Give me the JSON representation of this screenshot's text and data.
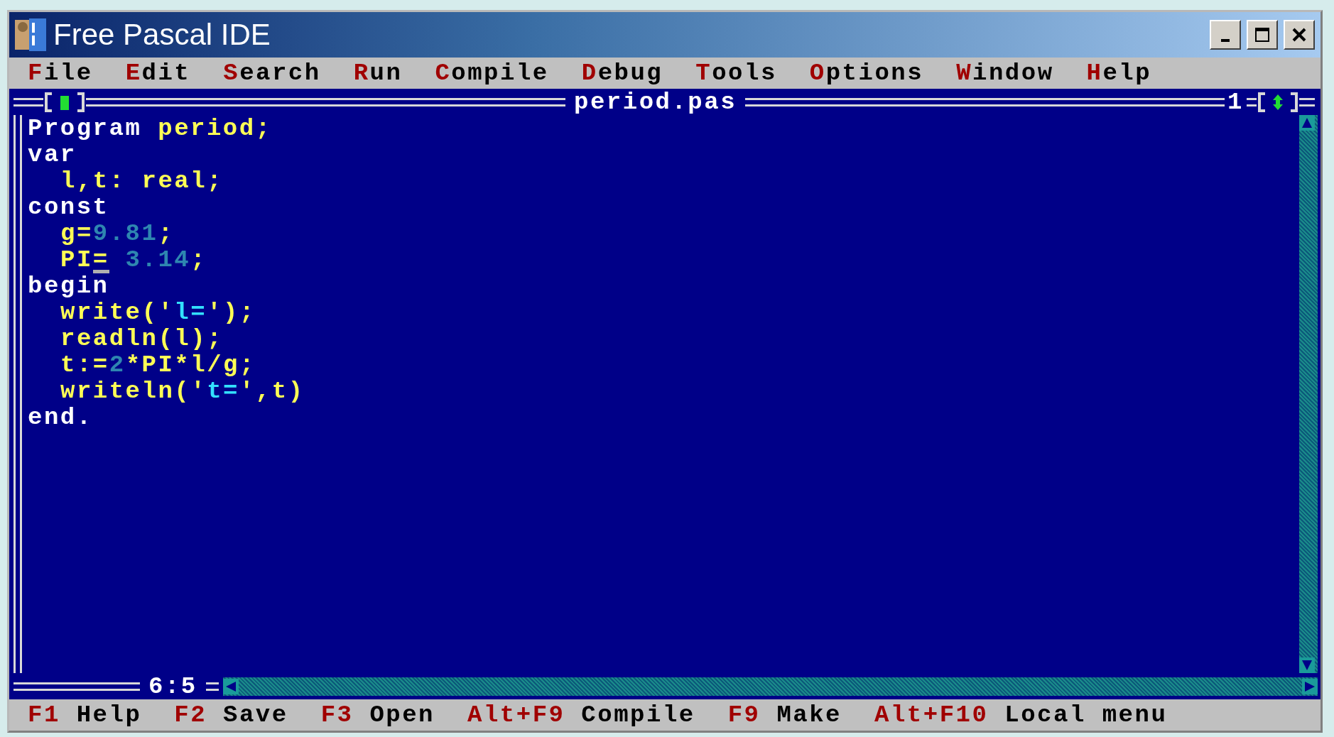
{
  "window": {
    "title": "Free Pascal IDE"
  },
  "menu": [
    {
      "hotkey": "F",
      "rest": "ile"
    },
    {
      "hotkey": "E",
      "rest": "dit"
    },
    {
      "hotkey": "S",
      "rest": "earch"
    },
    {
      "hotkey": "R",
      "rest": "un"
    },
    {
      "hotkey": "C",
      "rest": "ompile"
    },
    {
      "hotkey": "D",
      "rest": "ebug"
    },
    {
      "hotkey": "T",
      "rest": "ools"
    },
    {
      "hotkey": "O",
      "rest": "ptions"
    },
    {
      "hotkey": "W",
      "rest": "indow"
    },
    {
      "hotkey": "H",
      "rest": "elp"
    }
  ],
  "editor": {
    "file_name": "period.pas",
    "window_number": "1",
    "position": "6:5",
    "lines": [
      {
        "indent": false,
        "tokens": [
          {
            "text": "Program",
            "kind": "reserved",
            "cursor": false
          },
          {
            "text": " period;",
            "kind": "ident",
            "cursor": false
          }
        ]
      },
      {
        "indent": false,
        "tokens": [
          {
            "text": "var",
            "kind": "reserved",
            "cursor": false
          }
        ]
      },
      {
        "indent": true,
        "tokens": [
          {
            "text": "l,t: real;",
            "kind": "ident",
            "cursor": false
          }
        ]
      },
      {
        "indent": false,
        "tokens": [
          {
            "text": "const",
            "kind": "reserved",
            "cursor": false
          }
        ]
      },
      {
        "indent": true,
        "tokens": [
          {
            "text": "g=",
            "kind": "ident",
            "cursor": false
          },
          {
            "text": "9.81",
            "kind": "number",
            "cursor": false
          },
          {
            "text": ";",
            "kind": "ident",
            "cursor": false
          }
        ]
      },
      {
        "indent": true,
        "tokens": [
          {
            "text": "PI",
            "kind": "ident",
            "cursor": false
          },
          {
            "text": "=",
            "kind": "ident",
            "cursor": true
          },
          {
            "text": " 3.14",
            "kind": "number",
            "cursor": false
          },
          {
            "text": ";",
            "kind": "ident",
            "cursor": false
          }
        ]
      },
      {
        "indent": false,
        "tokens": [
          {
            "text": "begin",
            "kind": "reserved",
            "cursor": false
          }
        ]
      },
      {
        "indent": true,
        "tokens": [
          {
            "text": "write('",
            "kind": "ident",
            "cursor": false
          },
          {
            "text": "l=",
            "kind": "string",
            "cursor": false
          },
          {
            "text": "');",
            "kind": "ident",
            "cursor": false
          }
        ]
      },
      {
        "indent": true,
        "tokens": [
          {
            "text": "readln(l);",
            "kind": "ident",
            "cursor": false
          }
        ]
      },
      {
        "indent": true,
        "tokens": [
          {
            "text": "t:=",
            "kind": "ident",
            "cursor": false
          },
          {
            "text": "2",
            "kind": "number",
            "cursor": false
          },
          {
            "text": "*PI*l/g;",
            "kind": "ident",
            "cursor": false
          }
        ]
      },
      {
        "indent": true,
        "tokens": [
          {
            "text": "writeln('",
            "kind": "ident",
            "cursor": false
          },
          {
            "text": "t=",
            "kind": "string",
            "cursor": false
          },
          {
            "text": "',t)",
            "kind": "ident",
            "cursor": false
          }
        ]
      },
      {
        "indent": false,
        "tokens": [
          {
            "text": "end.",
            "kind": "reserved",
            "cursor": false
          }
        ]
      }
    ]
  },
  "status_bar": [
    {
      "key": "F1",
      "label": "Help"
    },
    {
      "key": "F2",
      "label": "Save"
    },
    {
      "key": "F3",
      "label": "Open"
    },
    {
      "key": "Alt+F9",
      "label": "Compile"
    },
    {
      "key": "F9",
      "label": "Make"
    },
    {
      "key": "Alt+F10",
      "label": "Local menu"
    }
  ]
}
